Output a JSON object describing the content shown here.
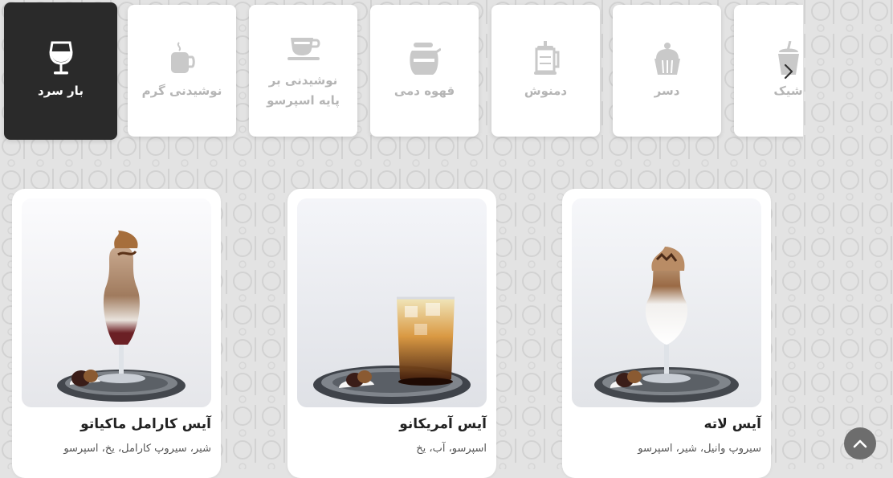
{
  "categories": [
    {
      "label": "بار سرد",
      "icon": "wine-glass-icon"
    },
    {
      "label": "نوشیدنی گرم",
      "icon": "hot-cup-icon"
    },
    {
      "label": "نوشیدنی بر پایه اسپرسو",
      "icon": "espresso-cup-icon"
    },
    {
      "label": "قهوه دمی",
      "icon": "coffee-pot-icon"
    },
    {
      "label": "دمنوش",
      "icon": "french-press-icon"
    },
    {
      "label": "دسر",
      "icon": "cupcake-icon"
    },
    {
      "label": "شیک",
      "icon": "shake-cup-icon"
    }
  ],
  "products": [
    {
      "name": "آیس لاته",
      "description": "سیروپ وانیل، شیر، اسپرسو"
    },
    {
      "name": "آیس آمریکانو",
      "description": "اسپرسو، آب، یخ"
    },
    {
      "name": "آیس کارامل ماکیاتو",
      "description": "شیر، سیروپ کارامل، یخ، اسپرسو"
    }
  ],
  "colors": {
    "background": "#e3e3e3",
    "active_category": "#2a2a2a",
    "inactive_icon": "#b5b5b5",
    "scroll_top_button": "#6d6d6d"
  }
}
